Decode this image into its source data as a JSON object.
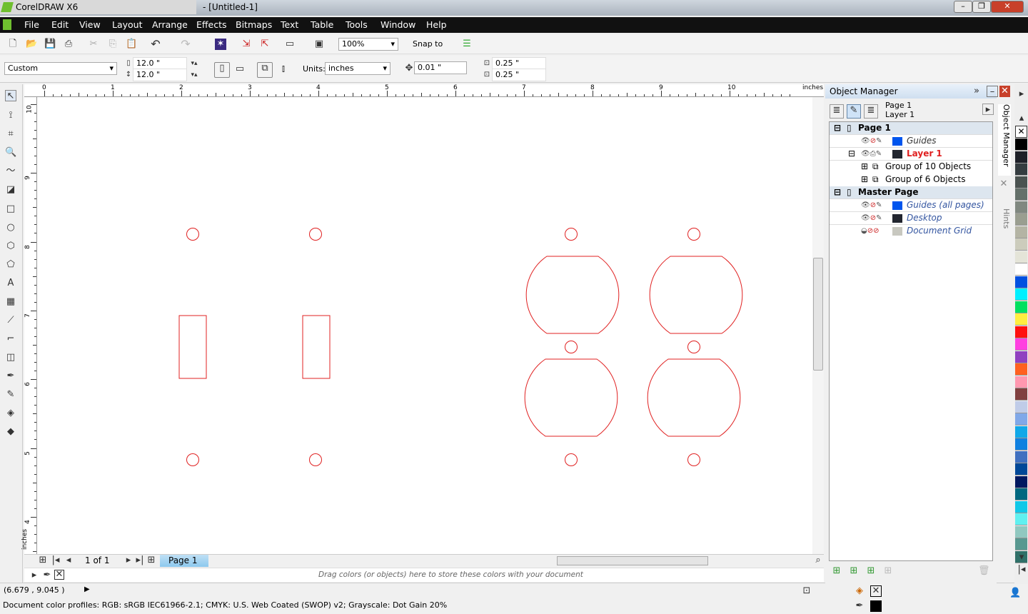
{
  "app": {
    "title": "CorelDRAW X6",
    "doc_title": "- [Untitled-1]"
  },
  "menu": [
    "File",
    "Edit",
    "View",
    "Layout",
    "Arrange",
    "Effects",
    "Bitmaps",
    "Text",
    "Table",
    "Tools",
    "Window",
    "Help"
  ],
  "toolbar": {
    "zoom": "100%",
    "snap_to": "Snap to"
  },
  "property_bar": {
    "page_size": "Custom",
    "width": "12.0 \"",
    "height": "12.0 \"",
    "units_label": "Units:",
    "units": "inches",
    "nudge": "0.01 \"",
    "dup_x": "0.25 \"",
    "dup_y": "0.25 \""
  },
  "ruler": {
    "unit": "inches",
    "h_ticks": [
      "0",
      "1",
      "2",
      "3",
      "4",
      "5",
      "6",
      "7",
      "8",
      "9",
      "10"
    ],
    "v_ticks": [
      "10",
      "9",
      "8",
      "7",
      "6",
      "5",
      "4"
    ]
  },
  "page_nav": {
    "counter": "1 of 1",
    "tab": "Page 1"
  },
  "doc_palette": {
    "hint": "Drag colors (or objects) here to store these colors with your document"
  },
  "status": {
    "coords": "(6.679 , 9.045 )",
    "profiles": "Document color profiles: RGB: sRGB IEC61966-2.1; CMYK: U.S. Web Coated (SWOP) v2; Grayscale: Dot Gain 20%"
  },
  "object_manager": {
    "title": "Object Manager",
    "current_page": "Page 1",
    "current_layer": "Layer 1",
    "rows": [
      {
        "label": "Page 1",
        "type": "page"
      },
      {
        "label": "Guides",
        "type": "layer",
        "color": "#0055ee"
      },
      {
        "label": "Layer 1",
        "type": "active-layer",
        "color": "#222630"
      },
      {
        "label": "Group of 10 Objects",
        "type": "group"
      },
      {
        "label": "Group of 6 Objects",
        "type": "group"
      },
      {
        "label": "Master Page",
        "type": "page"
      },
      {
        "label": "Guides (all pages)",
        "type": "master-layer",
        "color": "#0055ee"
      },
      {
        "label": "Desktop",
        "type": "master-layer",
        "color": "#222630"
      },
      {
        "label": "Document Grid",
        "type": "master-layer",
        "color": "#c8c8c0"
      }
    ]
  },
  "side_tabs": {
    "object_manager": "Object Manager",
    "hints": "Hints"
  },
  "palette_colors": [
    "#000000",
    "#1e2028",
    "#343c40",
    "#4a5250",
    "#64706a",
    "#808880",
    "#9a9e90",
    "#b4b4a4",
    "#ccccbc",
    "#e4e4d8",
    "#ffffff",
    "#0050e0",
    "#00f0ff",
    "#00e060",
    "#ffee40",
    "#ff1010",
    "#ff40e0",
    "#9040c0",
    "#ff6020",
    "#ff98b0",
    "#804040",
    "#c0cce8",
    "#80a8e8",
    "#10a8e8",
    "#1080e0",
    "#4070c0",
    "#004898",
    "#001860",
    "#006880",
    "#10c8e8",
    "#60f0f0",
    "#90c8c0",
    "#589890",
    "#307068"
  ],
  "outline_color": "#e02020"
}
